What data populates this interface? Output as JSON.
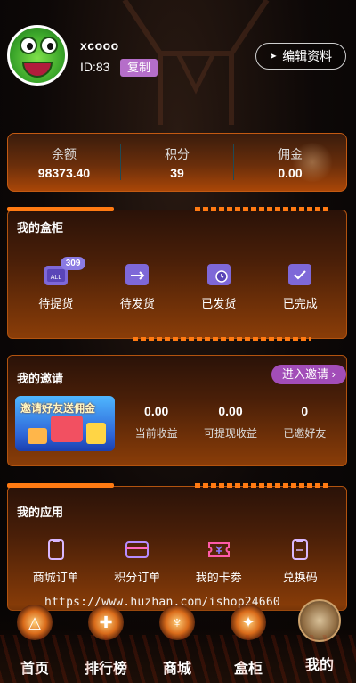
{
  "user": {
    "name": "xcooo",
    "id_text": "ID:83",
    "copy_label": "复制",
    "edit_label": "编辑资料"
  },
  "stats": [
    {
      "label": "余额",
      "value": "98373.40"
    },
    {
      "label": "积分",
      "value": "39"
    },
    {
      "label": "佣金",
      "value": "0.00"
    }
  ],
  "cabinet": {
    "title": "我的盒柜",
    "items": [
      {
        "label": "待提货",
        "badge": "309",
        "icon": "box-all-icon"
      },
      {
        "label": "待发货",
        "icon": "box-pending-ship-icon"
      },
      {
        "label": "已发货",
        "icon": "box-shipped-icon"
      },
      {
        "label": "已完成",
        "icon": "box-complete-icon"
      }
    ],
    "icon_text_all": "ALL"
  },
  "invite": {
    "title": "我的邀请",
    "button_label": "进入邀请",
    "banner_text": "邀请好友送佣金",
    "stats": [
      {
        "value": "0.00",
        "label": "当前收益"
      },
      {
        "value": "0.00",
        "label": "可提现收益"
      },
      {
        "value": "0",
        "label": "已邀好友"
      }
    ]
  },
  "apps": {
    "title": "我的应用",
    "items": [
      {
        "label": "商城订单",
        "icon": "clipboard-icon"
      },
      {
        "label": "积分订单",
        "icon": "card-icon"
      },
      {
        "label": "我的卡劵",
        "icon": "coupon-icon"
      },
      {
        "label": "兑换码",
        "icon": "clipboard-code-icon"
      }
    ]
  },
  "watermark": "https://www.huzhan.com/ishop24660",
  "nav": [
    {
      "label": "首页",
      "icon": "home-icon"
    },
    {
      "label": "排行榜",
      "icon": "ranking-icon"
    },
    {
      "label": "商城",
      "icon": "mall-icon"
    },
    {
      "label": "盒柜",
      "icon": "cabinet-icon"
    },
    {
      "label": "我的",
      "icon": "profile-icon"
    }
  ],
  "colors": {
    "accent_orange": "#ff7a12",
    "purple_button": "#a24db8",
    "copy_button": "#b56ec9",
    "icon_purple": "#8b7be3"
  }
}
